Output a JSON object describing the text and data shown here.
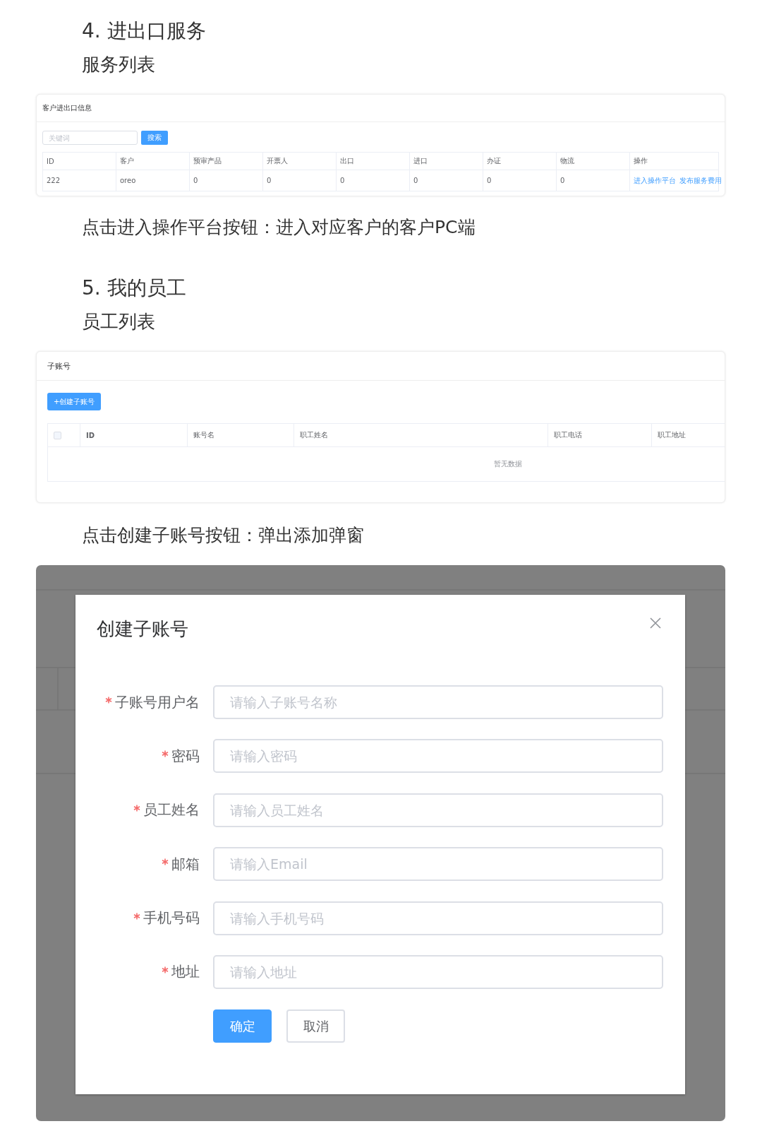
{
  "section_4": {
    "heading": "4. 进出口服务",
    "subheading": "服务列表",
    "panel": {
      "title": "客户进出口信息",
      "search": {
        "placeholder": "关键词",
        "button": "搜索"
      },
      "columns": [
        "ID",
        "客户",
        "预审产品",
        "开票人",
        "出口",
        "进口",
        "办证",
        "物流",
        "操作"
      ],
      "rows": [
        {
          "cells": [
            "222",
            "oreo",
            "0",
            "0",
            "0",
            "0",
            "0",
            "0"
          ],
          "actions": [
            "进入操作平台",
            "发布服务费用"
          ]
        }
      ]
    },
    "note": "点击进入操作平台按钮：进入对应客户的客户PC端"
  },
  "section_5": {
    "heading": "5. 我的员工",
    "subheading": "员工列表",
    "panel": {
      "title": "子账号",
      "create_button": "+创建子账号",
      "select_all": {
        "checked": false
      },
      "columns": [
        "ID",
        "账号名",
        "职工姓名",
        "职工电话",
        "职工地址"
      ],
      "empty_text": "暂无数据"
    },
    "note": "点击创建子账号按钮：弹出添加弹窗"
  },
  "dialog": {
    "title": "创建子账号",
    "fields": [
      {
        "label": "子账号用户名",
        "placeholder": "请输入子账号名称",
        "required": true
      },
      {
        "label": "密码",
        "placeholder": "请输入密码",
        "required": true
      },
      {
        "label": "员工姓名",
        "placeholder": "请输入员工姓名",
        "required": true
      },
      {
        "label": "邮箱",
        "placeholder": "请输入Email",
        "required": true
      },
      {
        "label": "手机号码",
        "placeholder": "请输入手机号码",
        "required": true
      },
      {
        "label": "地址",
        "placeholder": "请输入地址",
        "required": true
      }
    ],
    "buttons": [
      {
        "label": "确定",
        "kind": "primary"
      },
      {
        "label": "取消",
        "kind": "default"
      }
    ]
  }
}
